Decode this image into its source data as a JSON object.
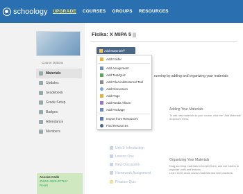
{
  "topbar": {
    "logo": "schoology",
    "nav": {
      "upgrade": "UPGRADE",
      "courses": "COURSES",
      "groups": "GROUPS",
      "resources": "RESOURCES"
    }
  },
  "sidebar": {
    "course_options": "Course Options",
    "items": [
      {
        "label": "Materials",
        "active": true
      },
      {
        "label": "Updates"
      },
      {
        "label": "Gradebook"
      },
      {
        "label": "Grade Setup"
      },
      {
        "label": "Badges"
      },
      {
        "label": "Attendance"
      },
      {
        "label": "Members"
      }
    ],
    "access_code": {
      "label": "Access Code",
      "code": "ZNW4-J8K9-8FTHK",
      "action": "Reset"
    }
  },
  "main": {
    "title": "Fisika: X MIPA 5",
    "add_materials": "Add Materials",
    "menu": [
      "Add Folder",
      "Add Assignment",
      "Add Test/Quiz",
      "Add File/Link/External Tool",
      "Add Discussion",
      "Add Page",
      "Add Media Album",
      "Add Package",
      "Import from Resources",
      "Find Resources"
    ],
    "running_text": "running by adding and organizing your materials",
    "hint1": {
      "title": "Adding Your Materials",
      "body": "To add new materials to your course, click the \"Add Materials\" dropdown menu."
    },
    "hint2": {
      "title": "Organizing Your Materials",
      "body": "Drag and drop materials to reorder them, and use folders to organize units and lessons."
    },
    "hint2_more": "Learn more about course materials and best practices.",
    "ghost_items": [
      "Unit 1: Introduction",
      "Lesson One",
      "New Discussion",
      "Homework Assignment",
      "Practice Quiz"
    ]
  }
}
